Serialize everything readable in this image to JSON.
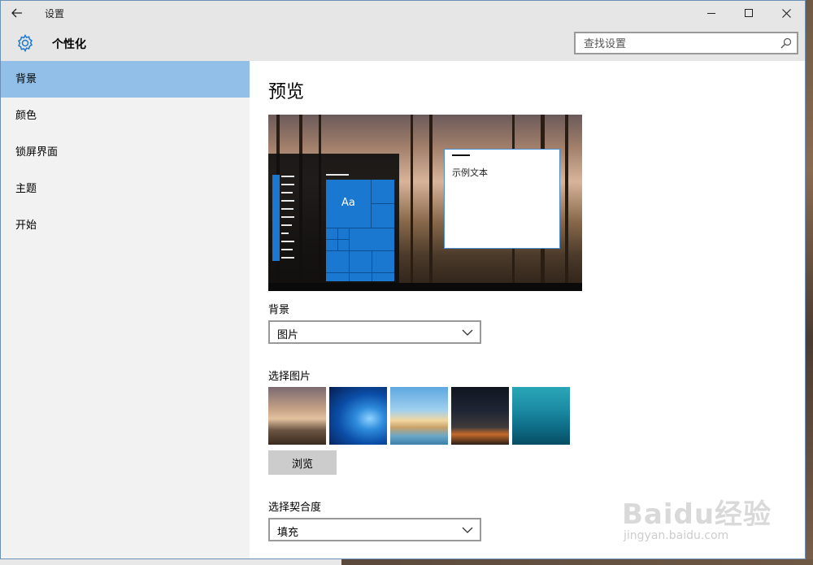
{
  "window": {
    "title": "设置",
    "back_icon": "back-arrow-icon",
    "controls": [
      "minimize-icon",
      "maximize-icon",
      "close-icon"
    ]
  },
  "header": {
    "icon": "gear-icon",
    "title": "个性化",
    "search": {
      "placeholder": "查找设置",
      "value": ""
    }
  },
  "sidebar": {
    "items": [
      {
        "label": "背景",
        "selected": true
      },
      {
        "label": "颜色",
        "selected": false
      },
      {
        "label": "锁屏界面",
        "selected": false
      },
      {
        "label": "主题",
        "selected": false
      },
      {
        "label": "开始",
        "selected": false
      }
    ]
  },
  "main": {
    "title": "预览",
    "preview": {
      "sample_text": "示例文本",
      "tile_text": "Aa",
      "accent_color": "#1a78d0"
    },
    "background": {
      "label": "背景",
      "value": "图片"
    },
    "choose_picture": {
      "label": "选择图片",
      "thumbnails": [
        "forest-lake",
        "windows-hero",
        "beach-rocks",
        "night-sky-tent",
        "underwater-swimmer"
      ]
    },
    "browse_label": "浏览",
    "fit": {
      "label": "选择契合度",
      "value": "填充"
    }
  },
  "watermark": {
    "brand": "Baidu经验",
    "url": "jingyan.baidu.com"
  }
}
